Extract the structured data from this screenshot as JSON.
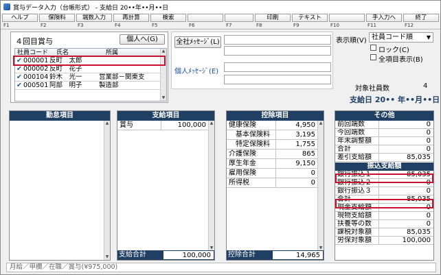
{
  "window": {
    "title": "賞与データ入力（台帳形式） - 支給日 20••年••月••日"
  },
  "fkeys": [
    {
      "label": "ヘルプ",
      "key": "F1"
    },
    {
      "label": "保険料",
      "key": "F2"
    },
    {
      "label": "端数入力",
      "key": "F3"
    },
    {
      "label": "再計算",
      "key": "F4"
    },
    {
      "label": "検索",
      "key": "F5"
    },
    {
      "label": "",
      "key": "F6"
    },
    {
      "label": "",
      "key": "F7"
    },
    {
      "label": "印刷",
      "key": "F8"
    },
    {
      "label": "テキスト",
      "key": "F9"
    },
    {
      "label": "",
      "key": "F10"
    },
    {
      "label": "手入力へ",
      "key": "F11"
    },
    {
      "label": "終了",
      "key": "F12"
    }
  ],
  "employees": {
    "title": "４回目賞与",
    "individual_button": "個人へ(G)",
    "columns": [
      "社員コード",
      "氏名",
      "所属"
    ],
    "rows": [
      {
        "code": "000001",
        "name": "反町　太郎",
        "dept": ""
      },
      {
        "code": "000002",
        "name": "反町　花子",
        "dept": ""
      },
      {
        "code": "000104",
        "name": "鈴木　光一",
        "dept": "営業部－関東支"
      },
      {
        "code": "000501",
        "name": "阿部　明子",
        "dept": "製造部"
      }
    ]
  },
  "messages": {
    "company_button": "全社ﾒｯｾｰｼﾞ(L)",
    "personal_label": "個人ﾒｯｾｰｼﾞ(E)"
  },
  "display": {
    "order_label": "表示順(V)",
    "order_value": "社員コード順",
    "lock_label": "ロック(C)",
    "all_label": "全項目表示(B)"
  },
  "summary": {
    "target_label": "対象社員数",
    "target_value": "4",
    "pay_date": "支給日 20•• 年••月••日"
  },
  "attendance": {
    "title": "勤怠項目"
  },
  "payment": {
    "title": "支給項目",
    "items": [
      {
        "k": "賞与",
        "v": "100,000"
      }
    ],
    "total_label": "支給合計",
    "total_value": "100,000"
  },
  "deduction": {
    "title": "控除項目",
    "items": [
      {
        "k": "健康保険",
        "v": "4,950"
      },
      {
        "k": "　基本保険料",
        "v": "3,195"
      },
      {
        "k": "　特定保険料",
        "v": "1,755"
      },
      {
        "k": "介護保険",
        "v": "865"
      },
      {
        "k": "厚生年金",
        "v": "9,150"
      },
      {
        "k": "雇用保険",
        "v": "0"
      },
      {
        "k": "所得税",
        "v": "0"
      }
    ],
    "total_label": "控除合計",
    "total_value": "14,965"
  },
  "other": {
    "title": "その他",
    "items": [
      {
        "k": "前回端数",
        "v": "0"
      },
      {
        "k": "今回端数",
        "v": "0"
      },
      {
        "k": "年末調整額",
        "v": "0"
      },
      {
        "k": "合計",
        "v": "0"
      },
      {
        "k": "差引支給額",
        "v": "85,035"
      }
    ],
    "transfer_title": "振込支給額",
    "transfers": [
      {
        "k": "銀行振込１",
        "v": "85,035"
      },
      {
        "k": "銀行振込２",
        "v": "0"
      },
      {
        "k": "銀行振込３",
        "v": "0"
      },
      {
        "k": "合計",
        "v": "85,035"
      }
    ],
    "rest": [
      {
        "k": "現金支給額",
        "v": "0"
      },
      {
        "k": "現物支給額",
        "v": "0"
      },
      {
        "k": "扶養等の数",
        "v": "0"
      },
      {
        "k": "課税対象額",
        "v": "85,035"
      },
      {
        "k": "労保対象額",
        "v": "100,000"
      }
    ]
  },
  "status": {
    "text": "月給／甲欄／在職／賞与(¥975,000)"
  },
  "colors": {
    "navy": "#1f3f63",
    "red": "#c8102e"
  }
}
